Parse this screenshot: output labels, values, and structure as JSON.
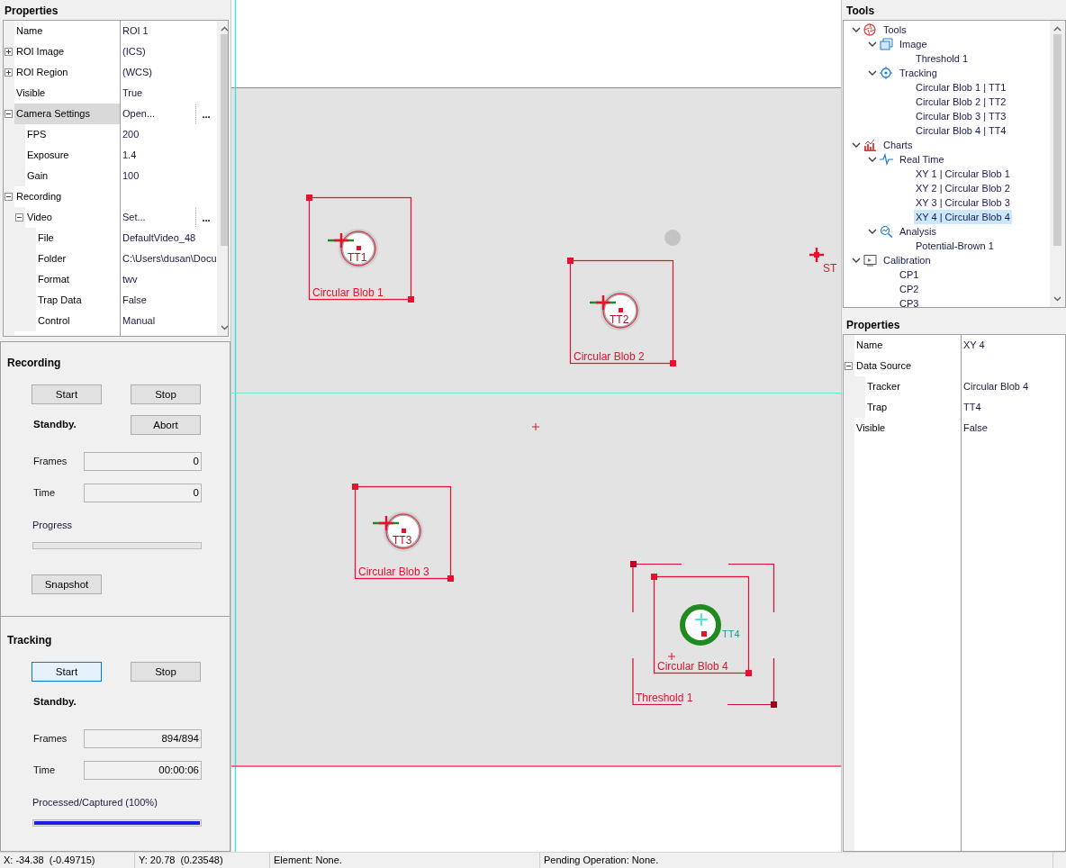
{
  "left_properties": {
    "title": "Properties",
    "rows": [
      {
        "name": "Name",
        "value": "ROI 1",
        "selected": false
      },
      {
        "name": "ROI Image",
        "value": "(ICS)",
        "expanded": false,
        "selected": false
      },
      {
        "name": "ROI Region",
        "value": "(WCS)",
        "expanded": false,
        "selected": false
      },
      {
        "name": "Visible",
        "value": "True",
        "selected": false
      },
      {
        "name": "Camera Settings",
        "value": "Open...",
        "button": "...",
        "expanded": true,
        "selected": true,
        "children": [
          {
            "name": "FPS",
            "value": "200",
            "selected": false
          },
          {
            "name": "Exposure",
            "value": "1.4",
            "selected": false
          },
          {
            "name": "Gain",
            "value": "100",
            "selected": false
          }
        ]
      },
      {
        "name": "Recording",
        "expanded": true,
        "selected": false,
        "children": [
          {
            "name": "Video",
            "value": "Set...",
            "button": "...",
            "expanded": true,
            "selected": false,
            "children": [
              {
                "name": "File",
                "value": "DefaultVideo_48",
                "selected": false
              },
              {
                "name": "Folder",
                "value": "C:\\Users\\dusan\\Docu",
                "selected": false
              },
              {
                "name": "Format",
                "value": "twv",
                "selected": false
              },
              {
                "name": "Trap Data",
                "value": "False",
                "selected": false
              },
              {
                "name": "Control",
                "value": "Manual",
                "selected": false
              }
            ]
          }
        ]
      }
    ]
  },
  "recording": {
    "title": "Recording",
    "start": {
      "label": "Start",
      "focused": false
    },
    "stop": "Stop",
    "status": "Standby.",
    "abort": "Abort",
    "frames": {
      "label": "Frames",
      "value": "0"
    },
    "time": {
      "label": "Time",
      "value": "0"
    },
    "progress": {
      "label": "Progress",
      "level": 0
    },
    "snapshot": "Snapshot"
  },
  "tracking": {
    "title": "Tracking",
    "start": {
      "label": "Start",
      "focused": true
    },
    "stop": "Stop",
    "status": "Standby.",
    "frames": {
      "label": "Frames",
      "value": "894/894"
    },
    "time": {
      "label": "Time",
      "value": "00:00:06"
    },
    "progress": {
      "label": "Processed/Captured (100%)",
      "level": 1
    }
  },
  "canvas": {
    "rois": [
      {
        "label": "Circular Blob 1",
        "trap": "TT1",
        "selected": false
      },
      {
        "label": "Circular Blob 2",
        "trap": "TT2",
        "selected": false
      },
      {
        "label": "Circular Blob 3",
        "trap": "TT3",
        "selected": false
      },
      {
        "label": "Circular Blob 4",
        "trap": "TT4",
        "selected": true
      }
    ],
    "threshold": {
      "label": "Threshold 1"
    },
    "marker": {
      "label": "ST"
    }
  },
  "tools": {
    "title": "Tools",
    "items": [
      {
        "label": "Tools",
        "kind": "tools",
        "expanded": true,
        "selected": false,
        "children": [
          {
            "label": "Image",
            "kind": "image",
            "expanded": true,
            "selected": false,
            "children": [
              {
                "label": "Threshold 1",
                "kind": "leaf",
                "selected": false
              }
            ]
          },
          {
            "label": "Tracking",
            "kind": "tracking",
            "expanded": true,
            "selected": false,
            "children": [
              {
                "label": "Circular Blob 1 | TT1",
                "kind": "leaf",
                "selected": false
              },
              {
                "label": "Circular Blob 2 | TT2",
                "kind": "leaf",
                "selected": false
              },
              {
                "label": "Circular Blob 3 | TT3",
                "kind": "leaf",
                "selected": false
              },
              {
                "label": "Circular Blob 4 | TT4",
                "kind": "leaf",
                "selected": false
              }
            ]
          }
        ]
      },
      {
        "label": "Charts",
        "kind": "charts",
        "expanded": true,
        "selected": false,
        "children": [
          {
            "label": "Real Time",
            "kind": "realtime",
            "expanded": true,
            "selected": false,
            "children": [
              {
                "label": "XY 1 | Circular Blob 1",
                "kind": "leaf",
                "selected": false
              },
              {
                "label": "XY 2 | Circular Blob 2",
                "kind": "leaf",
                "selected": false
              },
              {
                "label": "XY 3 | Circular Blob 3",
                "kind": "leaf",
                "selected": false
              },
              {
                "label": "XY 4 | Circular Blob 4",
                "kind": "leaf",
                "selected": true
              }
            ]
          },
          {
            "label": "Analysis",
            "kind": "analysis",
            "expanded": true,
            "selected": false,
            "children": [
              {
                "label": "Potential-Brown 1",
                "kind": "leaf",
                "selected": false
              }
            ]
          }
        ]
      },
      {
        "label": "Calibration",
        "kind": "calibration",
        "expanded": true,
        "selected": false,
        "children": [
          {
            "label": "CP1",
            "kind": "leaf",
            "selected": false
          },
          {
            "label": "CP2",
            "kind": "leaf",
            "selected": false
          },
          {
            "label": "CP3",
            "kind": "leaf",
            "selected": false
          }
        ]
      }
    ]
  },
  "right_properties": {
    "title": "Properties",
    "rows": [
      {
        "name": "Name",
        "value": "XY 4",
        "selected": false
      },
      {
        "name": "Data Source",
        "expanded": true,
        "selected": false,
        "children": [
          {
            "name": "Tracker",
            "value": "Circular Blob 4",
            "selected": false
          },
          {
            "name": "Trap",
            "value": "TT4",
            "selected": false
          }
        ]
      },
      {
        "name": "Visible",
        "value": "False",
        "selected": false
      }
    ]
  },
  "status_bar": [
    "X: -34.38  (-0.49715)",
    "Y: 20.78  (0.23548)",
    "Element: None.",
    "Pending Operation: None."
  ]
}
